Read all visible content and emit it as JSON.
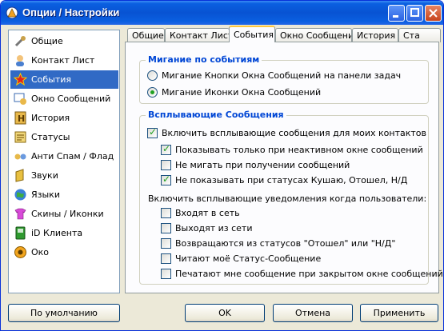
{
  "window": {
    "title": "Опции / Настройки"
  },
  "sidebar": {
    "items": [
      {
        "label": "Общие",
        "icon": "tools-icon"
      },
      {
        "label": "Контакт Лист",
        "icon": "contact-list-icon"
      },
      {
        "label": "События",
        "icon": "events-star-icon",
        "selected": true
      },
      {
        "label": "Окно Сообщений",
        "icon": "message-window-icon"
      },
      {
        "label": "История",
        "icon": "history-icon"
      },
      {
        "label": "Статусы",
        "icon": "statuses-icon"
      },
      {
        "label": "Анти Спам / Флад",
        "icon": "antispam-icon"
      },
      {
        "label": "Звуки",
        "icon": "sounds-icon"
      },
      {
        "label": "Языки",
        "icon": "languages-icon"
      },
      {
        "label": "Скины / Иконки",
        "icon": "skins-icon"
      },
      {
        "label": "iD Клиента",
        "icon": "client-id-icon"
      },
      {
        "label": "Око",
        "icon": "eye-icon"
      }
    ]
  },
  "tabs": [
    {
      "label": "Общие"
    },
    {
      "label": "Контакт Лист"
    },
    {
      "label": "События",
      "active": true
    },
    {
      "label": "Окно Сообщений"
    },
    {
      "label": "История"
    },
    {
      "label": "Ста"
    }
  ],
  "blink_group": {
    "title": "Мигание по событиям",
    "options": [
      {
        "label": "Мигание Кнопки Окна Сообщений на панели задач",
        "selected": false
      },
      {
        "label": "Мигание Иконки Окна Сообщений",
        "selected": true
      }
    ]
  },
  "popup_group": {
    "title": "Всплывающие Сообщения",
    "enable": {
      "label": "Включить всплывающие сообщения для моих контактов",
      "checked": true
    },
    "sub_options": [
      {
        "label": "Показывать только при неактивном окне сообщений",
        "checked": true
      },
      {
        "label": "Не мигать при получении сообщений",
        "checked": false
      },
      {
        "label": "Не показывать при статусах Кушаю, Отошел, Н/Д",
        "checked": true
      }
    ],
    "notify_label": "Включить всплывающие уведомления когда пользователи:",
    "notify_options": [
      {
        "label": "Входят в сеть",
        "checked": false
      },
      {
        "label": "Выходят из сети",
        "checked": false
      },
      {
        "label": "Возвращаются из статусов \"Отошел\" или \"Н/Д\"",
        "checked": false
      },
      {
        "label": "Читают моё Статус-Сообщение",
        "checked": false
      },
      {
        "label": "Печатают мне сообщение при закрытом окне сообщений",
        "checked": false
      }
    ]
  },
  "buttons": {
    "defaults": "По умолчанию",
    "ok": "OK",
    "cancel": "Отмена",
    "apply": "Применить"
  }
}
